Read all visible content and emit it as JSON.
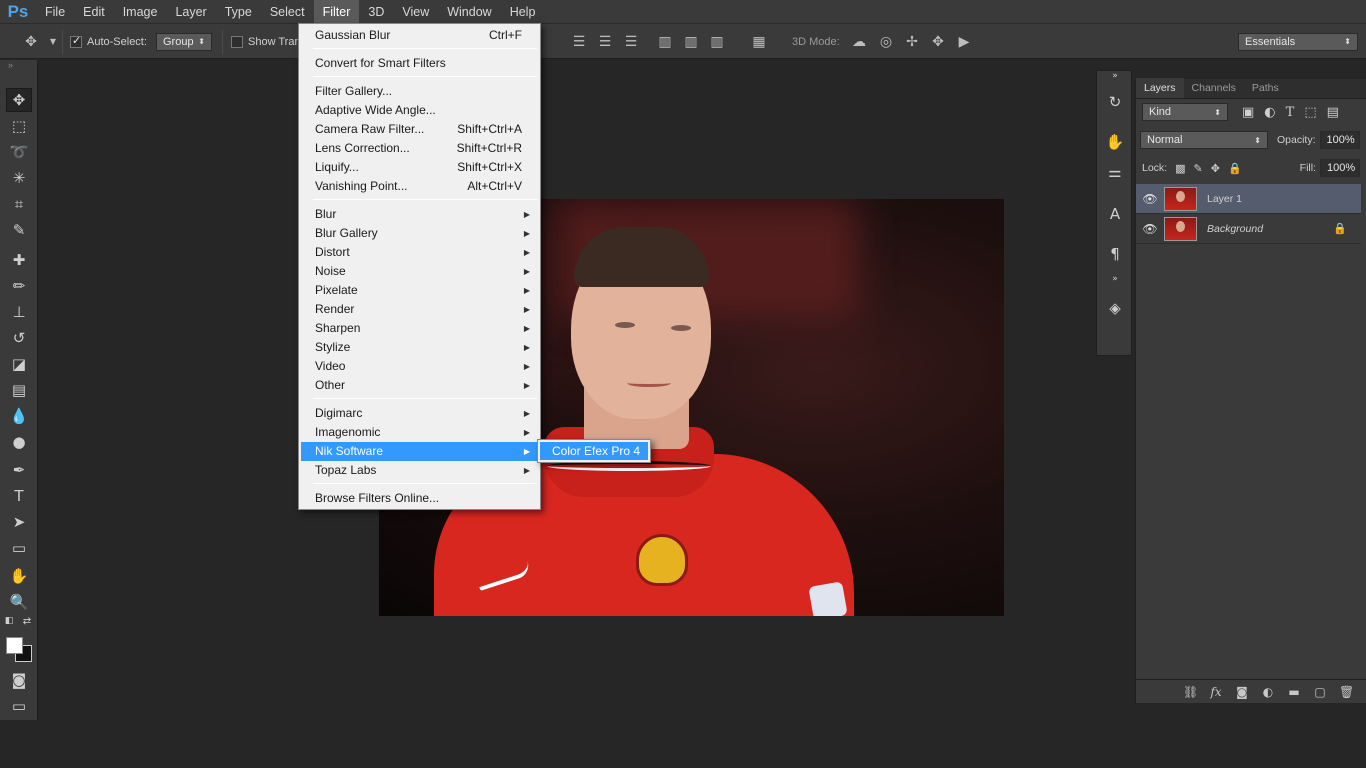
{
  "app": {
    "logo": "Ps"
  },
  "menubar": {
    "items": [
      "File",
      "Edit",
      "Image",
      "Layer",
      "Type",
      "Select",
      "Filter",
      "3D",
      "View",
      "Window",
      "Help"
    ],
    "active": "Filter"
  },
  "options": {
    "auto_select_label": "Auto-Select:",
    "auto_select_checked": true,
    "group_value": "Group",
    "show_transform_label": "Show Tran",
    "mode_3d_label": "3D Mode:",
    "workspace_value": "Essentials"
  },
  "filter_menu": {
    "items": [
      {
        "label": "Gaussian Blur",
        "shortcut": "Ctrl+F"
      },
      {
        "label": "Convert for Smart Filters",
        "shortcut": ""
      },
      {
        "label": "Filter Gallery...",
        "shortcut": ""
      },
      {
        "label": "Adaptive Wide Angle...",
        "shortcut": ""
      },
      {
        "label": "Camera Raw Filter...",
        "shortcut": "Shift+Ctrl+A"
      },
      {
        "label": "Lens Correction...",
        "shortcut": "Shift+Ctrl+R"
      },
      {
        "label": "Liquify...",
        "shortcut": "Shift+Ctrl+X"
      },
      {
        "label": "Vanishing Point...",
        "shortcut": "Alt+Ctrl+V"
      },
      {
        "label": "Blur",
        "shortcut": ""
      },
      {
        "label": "Blur Gallery",
        "shortcut": ""
      },
      {
        "label": "Distort",
        "shortcut": ""
      },
      {
        "label": "Noise",
        "shortcut": ""
      },
      {
        "label": "Pixelate",
        "shortcut": ""
      },
      {
        "label": "Render",
        "shortcut": ""
      },
      {
        "label": "Sharpen",
        "shortcut": ""
      },
      {
        "label": "Stylize",
        "shortcut": ""
      },
      {
        "label": "Video",
        "shortcut": ""
      },
      {
        "label": "Other",
        "shortcut": ""
      },
      {
        "label": "Digimarc",
        "shortcut": ""
      },
      {
        "label": "Imagenomic",
        "shortcut": ""
      },
      {
        "label": "Nik Software",
        "shortcut": ""
      },
      {
        "label": "Topaz Labs",
        "shortcut": ""
      },
      {
        "label": "Browse Filters Online...",
        "shortcut": ""
      }
    ],
    "highlighted": "Nik Software"
  },
  "submenu": {
    "items": [
      "Color Efex Pro 4"
    ]
  },
  "layers_panel": {
    "tabs": [
      "Layers",
      "Channels",
      "Paths"
    ],
    "active_tab": "Layers",
    "filter_kind": "Kind",
    "blend_mode": "Normal",
    "opacity_label": "Opacity:",
    "opacity_value": "100%",
    "lock_label": "Lock:",
    "fill_label": "Fill:",
    "fill_value": "100%",
    "layers": [
      {
        "name": "Layer 1",
        "selected": true,
        "locked": false
      },
      {
        "name": "Background",
        "selected": false,
        "locked": true
      }
    ]
  },
  "colors": {
    "highlight": "#3399ff",
    "ps_logo": "#4fa3e8",
    "foreground_swatch": "#ffffff",
    "background_swatch": "#111111"
  }
}
